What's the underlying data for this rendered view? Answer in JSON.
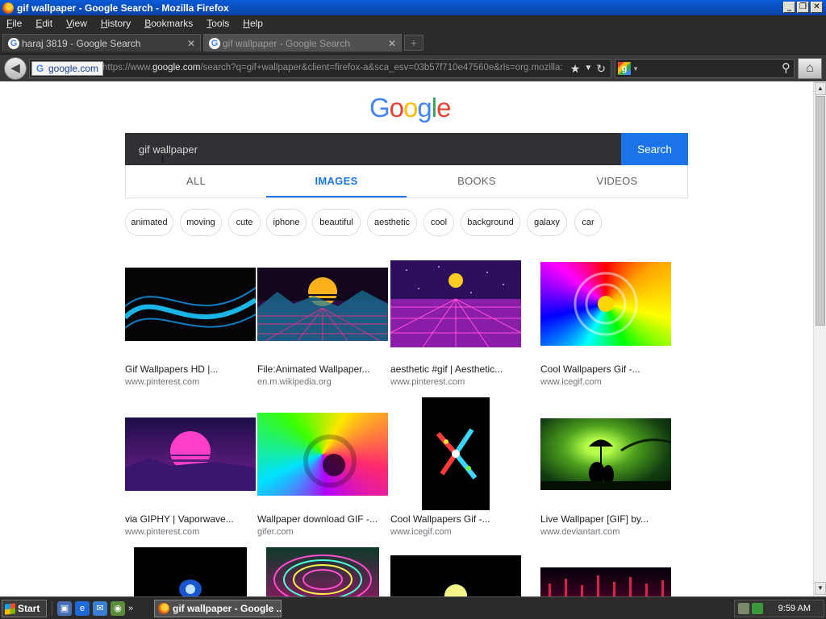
{
  "window": {
    "title": "gif wallpaper - Google Search - Mozilla Firefox",
    "controls": {
      "minimize": "_",
      "maximize": "❐",
      "close": "✕"
    }
  },
  "menubar": {
    "items": [
      {
        "label": "File",
        "accel": "F",
        "rest": "ile"
      },
      {
        "label": "Edit",
        "accel": "E",
        "rest": "dit"
      },
      {
        "label": "View",
        "accel": "V",
        "rest": "iew"
      },
      {
        "label": "History",
        "accel": "H",
        "rest": "istory"
      },
      {
        "label": "Bookmarks",
        "accel": "B",
        "rest": "ookmarks"
      },
      {
        "label": "Tools",
        "accel": "T",
        "rest": "ools"
      },
      {
        "label": "Help",
        "accel": "H",
        "rest": "elp"
      }
    ]
  },
  "tabs": [
    {
      "label": "haraj 3819 - Google Search",
      "active": false,
      "close": "✕"
    },
    {
      "label": "gif wallpaper - Google Search",
      "active": true,
      "close": "✕"
    }
  ],
  "newtab": {
    "symbol": "+"
  },
  "navbar": {
    "identity": "google.com",
    "url_prefix": "https://www.",
    "url_host": "google.com",
    "url_rest": "/search?q=gif+wallpaper&client=firefox-a&sca_esv=03b57f710e47560e&rls=org.mozilla:en-",
    "icons": {
      "bookmark": "★",
      "dropdown": "▼",
      "reload": "↻",
      "search": "⚲",
      "home": "⌂",
      "back": "◀"
    }
  },
  "google": {
    "logo_letters": [
      {
        "ch": "G",
        "color": "#4285F4"
      },
      {
        "ch": "o",
        "color": "#EA4335"
      },
      {
        "ch": "o",
        "color": "#FBBC05"
      },
      {
        "ch": "g",
        "color": "#4285F4"
      },
      {
        "ch": "l",
        "color": "#34A853"
      },
      {
        "ch": "e",
        "color": "#EA4335"
      }
    ],
    "query": "gif wallpaper",
    "search_button": "Search",
    "tabs": [
      {
        "label": "ALL",
        "active": false
      },
      {
        "label": "IMAGES",
        "active": true
      },
      {
        "label": "BOOKS",
        "active": false
      },
      {
        "label": "VIDEOS",
        "active": false
      }
    ],
    "chips": [
      "animated",
      "moving",
      "cute",
      "iphone",
      "beautiful",
      "aesthetic",
      "cool",
      "background",
      "galaxy",
      "car"
    ],
    "results": [
      {
        "title": "Gif Wallpapers HD |...",
        "site": "www.pinterest.com"
      },
      {
        "title": "File:Animated Wallpaper...",
        "site": "en.m.wikipedia.org"
      },
      {
        "title": "aesthetic #gif | Aesthetic...",
        "site": "www.pinterest.com"
      },
      {
        "title": "Cool Wallpapers Gif -...",
        "site": "www.icegif.com"
      },
      {
        "title": "via GIPHY | Vaporwave...",
        "site": "www.pinterest.com"
      },
      {
        "title": "Wallpaper download GIF -...",
        "site": "gifer.com"
      },
      {
        "title": "Cool Wallpapers Gif -...",
        "site": "www.icegif.com"
      },
      {
        "title": "Live Wallpaper [GIF] by...",
        "site": "www.deviantart.com"
      }
    ]
  },
  "scrollbar": {
    "up": "▲",
    "down": "▼"
  },
  "taskbar": {
    "start": "Start",
    "more": "»",
    "active_window": "gif wallpaper - Google ...",
    "clock": "9:59 AM"
  },
  "colors": {
    "accent": "#1a73e8",
    "titlebar": "#0a5ad6",
    "chrome_dark": "#2b2b2b"
  }
}
